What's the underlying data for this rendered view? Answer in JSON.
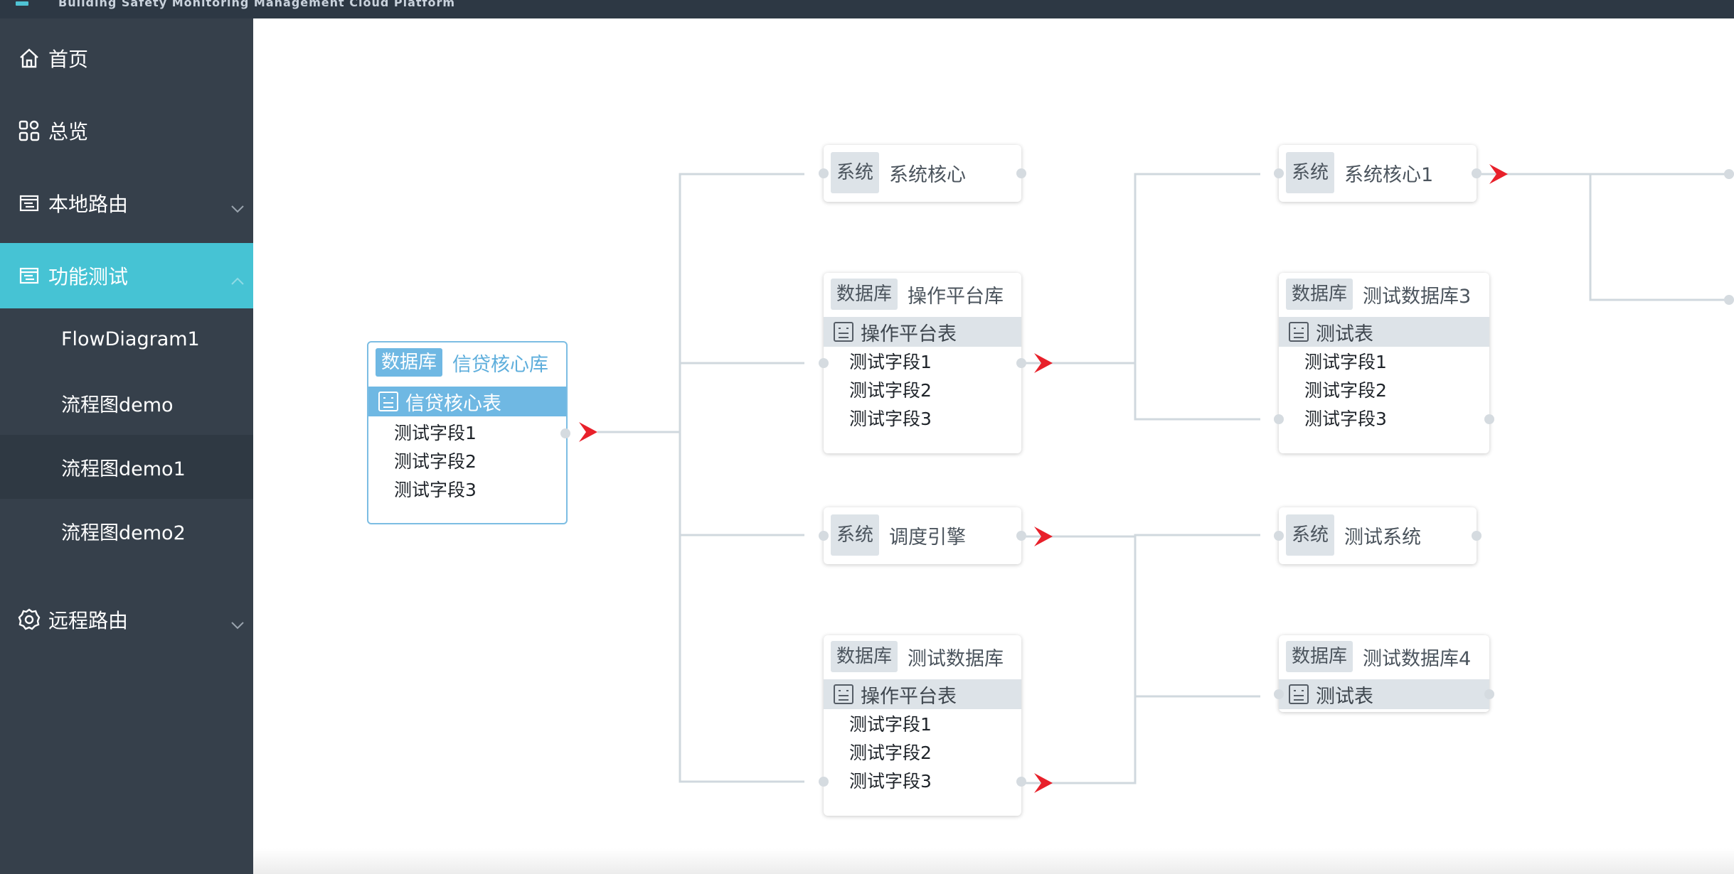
{
  "app": {
    "title": "Building Safety Monitoring Management Cloud Platform"
  },
  "sidebar": {
    "items": [
      {
        "label": "首页",
        "icon": "home-icon"
      },
      {
        "label": "总览",
        "icon": "grid-icon"
      },
      {
        "label": "本地路由",
        "icon": "route-icon",
        "expanded": false
      },
      {
        "label": "功能测试",
        "icon": "route-icon",
        "expanded": true,
        "active": true
      },
      {
        "label": "远程路由",
        "icon": "gear-icon",
        "expanded": false
      }
    ],
    "sub_items": [
      {
        "label": "FlowDiagram1"
      },
      {
        "label": "流程图demo"
      },
      {
        "label": "流程图demo1",
        "selected": true
      },
      {
        "label": "流程图demo2"
      }
    ]
  },
  "colors": {
    "sidebar_bg": "#36404b",
    "active_bg": "#46c3d4",
    "highlight": "#6fb8e3",
    "arrow": "#e8202a",
    "link": "#d0d8de"
  },
  "diagram": {
    "nodes": {
      "src": {
        "tag": "数据库",
        "title": "信贷核心库",
        "table": "信贷核心表",
        "fields": [
          "测试字段1",
          "测试字段2",
          "测试字段3"
        ]
      },
      "n1": {
        "tag": "系统",
        "title": "系统核心"
      },
      "n2": {
        "tag": "数据库",
        "title": "操作平台库",
        "table": "操作平台表",
        "fields": [
          "测试字段1",
          "测试字段2",
          "测试字段3"
        ]
      },
      "n3": {
        "tag": "系统",
        "title": "调度引擎"
      },
      "n4": {
        "tag": "数据库",
        "title": "测试数据库",
        "table": "操作平台表",
        "fields": [
          "测试字段1",
          "测试字段2",
          "测试字段3"
        ]
      },
      "m1": {
        "tag": "系统",
        "title": "系统核心1"
      },
      "m2": {
        "tag": "数据库",
        "title": "测试数据库3",
        "table": "测试表",
        "fields": [
          "测试字段1",
          "测试字段2",
          "测试字段3"
        ]
      },
      "m3": {
        "tag": "系统",
        "title": "测试系统"
      },
      "m4": {
        "tag": "数据库",
        "title": "测试数据库4",
        "table": "测试表"
      }
    }
  }
}
